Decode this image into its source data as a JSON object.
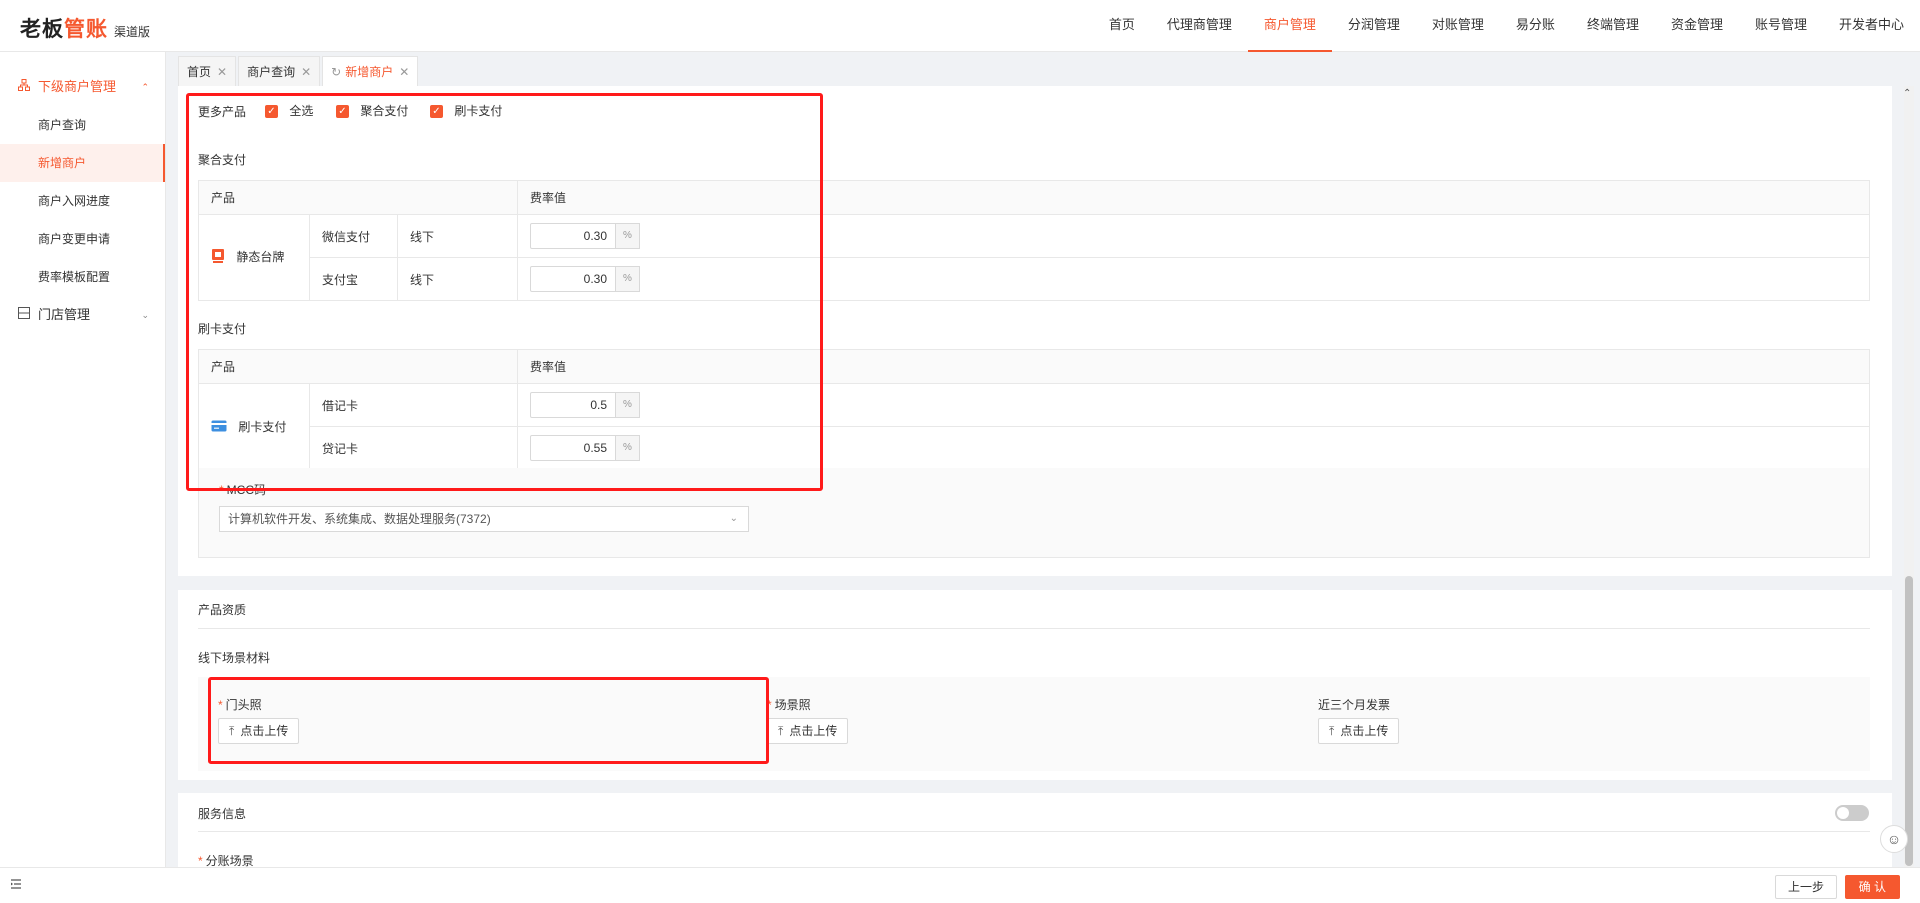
{
  "logo": {
    "part1": "老板",
    "part2": "管账",
    "suffix": "渠道版"
  },
  "topnav": [
    {
      "label": "首页"
    },
    {
      "label": "代理商管理"
    },
    {
      "label": "商户管理",
      "active": true
    },
    {
      "label": "分润管理"
    },
    {
      "label": "对账管理"
    },
    {
      "label": "易分账"
    },
    {
      "label": "终端管理"
    },
    {
      "label": "资金管理"
    },
    {
      "label": "账号管理"
    },
    {
      "label": "开发者中心"
    }
  ],
  "sidebar": {
    "group1": "下级商户管理",
    "items": [
      "商户查询",
      "新增商户",
      "商户入网进度",
      "商户变更申请",
      "费率模板配置"
    ],
    "group2": "门店管理"
  },
  "tabs": [
    {
      "label": "首页"
    },
    {
      "label": "商户查询"
    },
    {
      "label": "新增商户"
    }
  ],
  "more_products": {
    "label": "更多产品",
    "checkboxes": [
      "全选",
      "聚合支付",
      "刷卡支付"
    ]
  },
  "aggregate": {
    "title": "聚合支付",
    "col_product": "产品",
    "col_rate": "费率值",
    "product": "静态台牌",
    "rows": [
      {
        "channel": "微信支付",
        "mode": "线下",
        "rate": "0.30"
      },
      {
        "channel": "支付宝",
        "mode": "线下",
        "rate": "0.30"
      }
    ],
    "unit": "%"
  },
  "card": {
    "title": "刷卡支付",
    "col_product": "产品",
    "col_rate": "费率值",
    "product": "刷卡支付",
    "rows": [
      {
        "channel": "借记卡",
        "rate": "0.5"
      },
      {
        "channel": "贷记卡",
        "rate": "0.55"
      }
    ],
    "unit": "%"
  },
  "mcc": {
    "label": "MCC码",
    "value": "计算机软件开发、系统集成、数据处理服务(7372)"
  },
  "qualification": {
    "title": "产品资质",
    "subtitle": "线下场景材料",
    "fields": [
      {
        "label": "门头照",
        "required": true,
        "button": "点击上传"
      },
      {
        "label": "场景照",
        "required": true,
        "button": "点击上传"
      },
      {
        "label": "近三个月发票",
        "required": false,
        "button": "点击上传"
      }
    ]
  },
  "service": {
    "title": "服务信息",
    "field": "分账场景"
  },
  "footer": {
    "prev": "上一步",
    "confirm": "确 认"
  },
  "colors": {
    "accent": "#f5582f",
    "highlight": "#ff1a1a"
  }
}
